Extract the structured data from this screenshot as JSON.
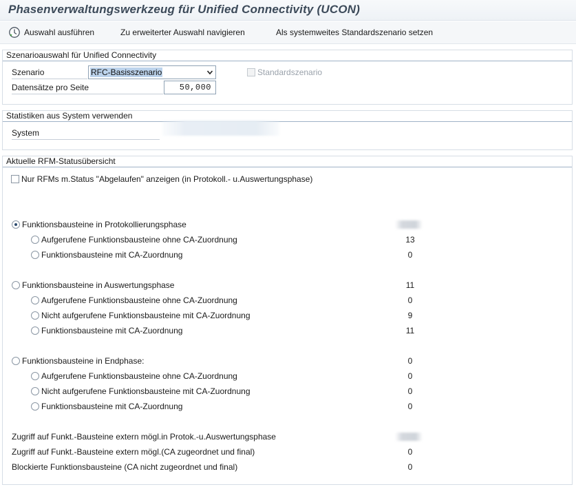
{
  "window": {
    "title": "Phasenverwaltungswerkzeug für Unified Connectivity (UCON)"
  },
  "toolbar": {
    "execute_label": "Auswahl ausführen",
    "extended_label": "Zu erweiterter Auswahl navigieren",
    "default_label": "Als systemweites Standardszenario setzen"
  },
  "scenario_group": {
    "title": "Szenarioauswahl für Unified Connectivity",
    "scenario_label": "Szenario",
    "scenario_value": "RFC-Basisszenario",
    "default_checkbox_label": "Standardszenario",
    "records_label": "Datensätze pro Seite",
    "records_value": "50,000"
  },
  "stats_group": {
    "title": "Statistiken aus System verwenden",
    "system_label": "System"
  },
  "status_group": {
    "title": "Aktuelle RFM-Statusübersicht",
    "expired_only_label": "Nur RFMs m.Status \"Abgelaufen\" anzeigen (in Protokoll.- u.Auswertungsphase)",
    "rows": [
      {
        "label": "Funktionsbausteine in Protokollierungsphase",
        "value": "",
        "level": 0,
        "checked": true,
        "blurred": true
      },
      {
        "label": "Aufgerufene Funktionsbausteine ohne CA-Zuordnung",
        "value": "13",
        "level": 1,
        "checked": false
      },
      {
        "label": "Funktionsbausteine mit CA-Zuordnung",
        "value": "0",
        "level": 1,
        "checked": false
      },
      {
        "label": "Funktionsbausteine in Auswertungsphase",
        "value": "11",
        "level": 0,
        "checked": false
      },
      {
        "label": "Aufgerufene Funktionsbausteine ohne CA-Zuordnung",
        "value": "0",
        "level": 1,
        "checked": false
      },
      {
        "label": "Nicht aufgerufene Funktionsbausteine mit CA-Zuordnung",
        "value": "9",
        "level": 1,
        "checked": false
      },
      {
        "label": "Funktionsbausteine mit CA-Zuordnung",
        "value": "11",
        "level": 1,
        "checked": false
      },
      {
        "label": "Funktionsbausteine in Endphase:",
        "value": "0",
        "level": 0,
        "checked": false
      },
      {
        "label": "Aufgerufene Funktionsbausteine ohne CA-Zuordnung",
        "value": "0",
        "level": 1,
        "checked": false
      },
      {
        "label": "Nicht aufgerufene Funktionsbausteine mit CA-Zuordnung",
        "value": "0",
        "level": 1,
        "checked": false
      },
      {
        "label": "Funktionsbausteine mit CA-Zuordnung",
        "value": "0",
        "level": 1,
        "checked": false
      }
    ],
    "access_rows": [
      {
        "label": "Zugriff auf Funkt.-Bausteine extern mögl.in Protok.-u.Auswertungsphase",
        "value": "",
        "blurred": true
      },
      {
        "label": "Zugriff auf Funkt.-Bausteine extern mögl.(CA zugeordnet und final)",
        "value": "0"
      },
      {
        "label": "Blockierte Funktionsbausteine (CA nicht zugeordnet und final)",
        "value": "0"
      }
    ]
  }
}
